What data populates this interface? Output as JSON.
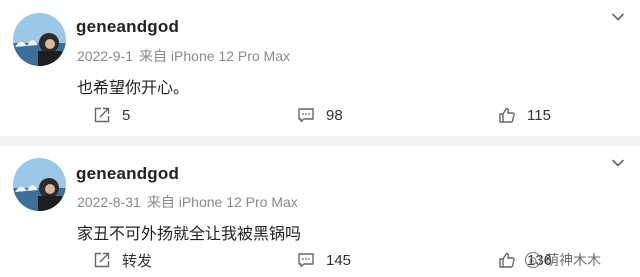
{
  "posts": [
    {
      "username": "geneandgod",
      "date": "2022-9-1",
      "source": "来自 iPhone 12 Pro Max",
      "text": "也希望你开心。",
      "reposts": "5",
      "comments": "98",
      "likes": "115"
    },
    {
      "username": "geneandgod",
      "date": "2022-8-31",
      "source": "来自 iPhone 12 Pro Max",
      "text": "家丑不可外扬就全让我被黑锅吗",
      "reposts": "转发",
      "comments": "145",
      "likes": "136"
    }
  ],
  "watermark": "萌神木木",
  "icons": {
    "repost": "repost-icon",
    "comment": "comment-icon",
    "like": "thumbs-up-icon",
    "more": "chevron-down-icon",
    "watermark": "weibo-logo-icon"
  },
  "colors": {
    "text": "#222222",
    "meta": "#8a8a8a",
    "separator": "#f2f2f2"
  }
}
